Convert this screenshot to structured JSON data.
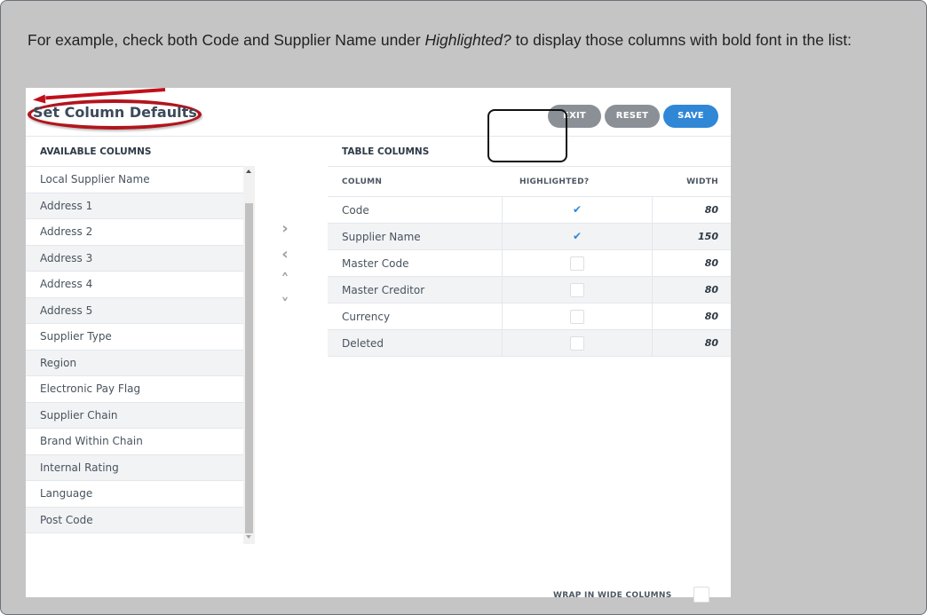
{
  "caption": {
    "part1": "For example, check both Code and Supplier Name under ",
    "emphasis": "Highlighted?",
    "part2": " to display those columns with bold font in the list:"
  },
  "dialog": {
    "title": "Set Column Defaults",
    "buttons": {
      "exit": "EXIT",
      "reset": "RESET",
      "save": "SAVE"
    }
  },
  "available_columns": {
    "heading": "AVAILABLE COLUMNS",
    "items": [
      "Local Supplier Name",
      "Address 1",
      "Address 2",
      "Address 3",
      "Address 4",
      "Address 5",
      "Supplier Type",
      "Region",
      "Electronic Pay Flag",
      "Supplier Chain",
      "Brand Within Chain",
      "Internal Rating",
      "Language",
      "Post Code"
    ]
  },
  "movers": {
    "right": "›",
    "left": "‹",
    "up": "˄",
    "down": "˅"
  },
  "table_columns": {
    "heading": "TABLE COLUMNS",
    "headers": {
      "column": "COLUMN",
      "highlighted": "HIGHLIGHTED?",
      "width": "WIDTH"
    },
    "rows": [
      {
        "column": "Code",
        "highlighted": true,
        "width": "80"
      },
      {
        "column": "Supplier Name",
        "highlighted": true,
        "width": "150"
      },
      {
        "column": "Master Code",
        "highlighted": false,
        "width": "80"
      },
      {
        "column": "Master Creditor",
        "highlighted": false,
        "width": "80"
      },
      {
        "column": "Currency",
        "highlighted": false,
        "width": "80"
      },
      {
        "column": "Deleted",
        "highlighted": false,
        "width": "80"
      }
    ]
  },
  "wrap": {
    "label": "WRAP IN WIDE COLUMNS",
    "checked": false
  },
  "colors": {
    "accent": "#2f87d6",
    "button_gray": "#8a9096",
    "annotation_red": "#b0161d"
  }
}
